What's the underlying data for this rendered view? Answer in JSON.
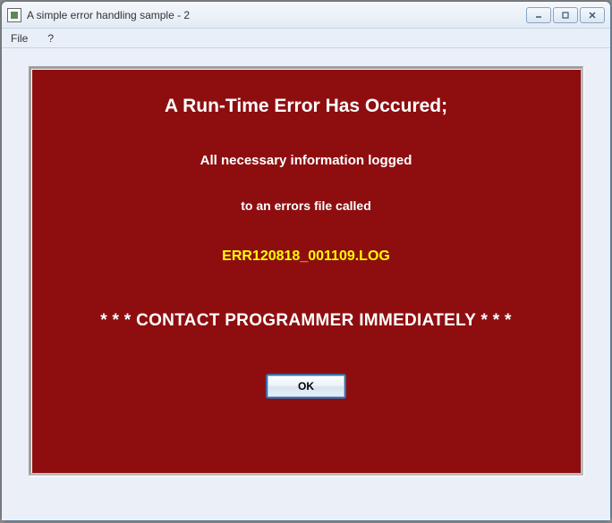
{
  "window": {
    "title": "A simple error handling sample - 2"
  },
  "menu": {
    "file": "File",
    "help": "?"
  },
  "error": {
    "heading": "A Run-Time Error Has Occured;",
    "line1": "All necessary information logged",
    "line2": "to an errors file called",
    "logfile": "ERR120818_001109.LOG",
    "contact": "* * * CONTACT PROGRAMMER IMMEDIATELY * * *",
    "ok_label": "OK"
  }
}
